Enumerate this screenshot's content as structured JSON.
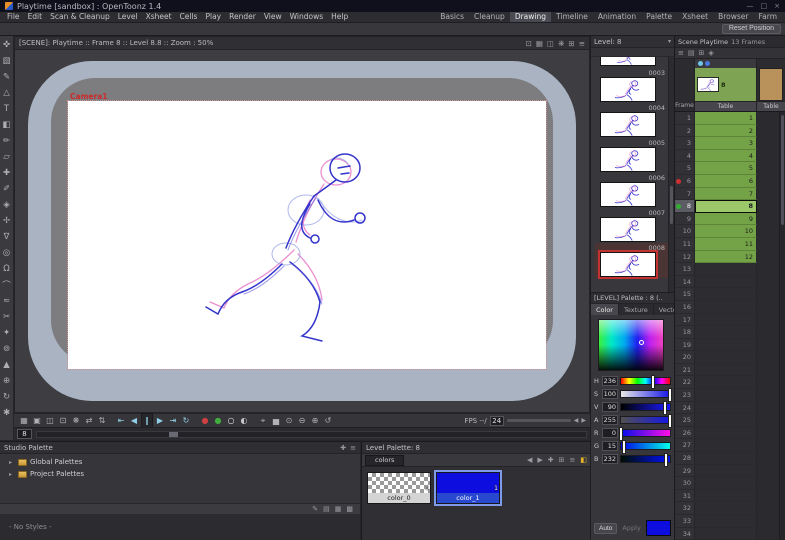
{
  "titlebar": {
    "title": "Playtime [sandbox] : OpenToonz 1.4",
    "window_buttons": [
      {
        "name": "minimize-button",
        "glyph": "—"
      },
      {
        "name": "maximize-button",
        "glyph": "□"
      },
      {
        "name": "close-button",
        "glyph": "×"
      }
    ]
  },
  "menubar": {
    "items": [
      {
        "label": "File",
        "name": "menu-file"
      },
      {
        "label": "Edit",
        "name": "menu-edit"
      },
      {
        "label": "Scan & Cleanup",
        "name": "menu-scan-cleanup"
      },
      {
        "label": "Level",
        "name": "menu-level"
      },
      {
        "label": "Xsheet",
        "name": "menu-xsheet"
      },
      {
        "label": "Cells",
        "name": "menu-cells"
      },
      {
        "label": "Play",
        "name": "menu-play"
      },
      {
        "label": "Render",
        "name": "menu-render"
      },
      {
        "label": "View",
        "name": "menu-view"
      },
      {
        "label": "Windows",
        "name": "menu-windows"
      },
      {
        "label": "Help",
        "name": "menu-help"
      }
    ],
    "rooms": [
      {
        "label": "Basics",
        "name": "room-tab-basics"
      },
      {
        "label": "Cleanup",
        "name": "room-tab-cleanup"
      },
      {
        "label": "Drawing",
        "name": "room-tab-drawing"
      },
      {
        "label": "Timeline",
        "name": "room-tab-timeline"
      },
      {
        "label": "Animation",
        "name": "room-tab-animation"
      },
      {
        "label": "Palette",
        "name": "room-tab-palette"
      },
      {
        "label": "Xsheet",
        "name": "room-tab-xsheet"
      },
      {
        "label": "Browser",
        "name": "room-tab-browser"
      },
      {
        "label": "Farm",
        "name": "room-tab-farm"
      }
    ],
    "active_room_index": 2
  },
  "toolbar_row": {
    "reset_button": "Reset Position"
  },
  "tools": [
    {
      "name": "animate-tool",
      "glyph": "✜"
    },
    {
      "name": "selection-tool",
      "glyph": "▧"
    },
    {
      "name": "brush-tool",
      "glyph": "✎"
    },
    {
      "name": "geometric-tool",
      "glyph": "△"
    },
    {
      "name": "type-tool",
      "glyph": "T"
    },
    {
      "name": "fill-tool",
      "glyph": "◧"
    },
    {
      "name": "paint-brush-tool",
      "glyph": "✏"
    },
    {
      "name": "eraser-tool",
      "glyph": "▱"
    },
    {
      "name": "tape-tool",
      "glyph": "✚"
    },
    {
      "name": "style-picker-tool",
      "glyph": "✐"
    },
    {
      "name": "rgb-picker-tool",
      "glyph": "◈"
    },
    {
      "name": "control-point-editor-tool",
      "glyph": "✢"
    },
    {
      "name": "pinch-tool",
      "glyph": "∇"
    },
    {
      "name": "pump-tool",
      "glyph": "◎"
    },
    {
      "name": "magnet-tool",
      "glyph": "Ω"
    },
    {
      "name": "bender-tool",
      "glyph": "⌒"
    },
    {
      "name": "iron-tool",
      "glyph": "≈"
    },
    {
      "name": "cutter-tool",
      "glyph": "✂"
    },
    {
      "name": "skeleton-tool",
      "glyph": "✦"
    },
    {
      "name": "hook-tool",
      "glyph": "⊚"
    },
    {
      "name": "plastic-tool",
      "glyph": "▲"
    },
    {
      "name": "zoom-tool",
      "glyph": "⊕"
    },
    {
      "name": "rotate-tool",
      "glyph": "↻"
    },
    {
      "name": "hand-tool",
      "glyph": "✱"
    }
  ],
  "viewer": {
    "title": "[SCENE]: Playtime  ::  Frame 8  ::  Level 8.8  ::  Zoom : 50%",
    "camera_label": "Camera1",
    "header_icons": [
      {
        "name": "safe-area-icon",
        "glyph": "⊡"
      },
      {
        "name": "field-guide-icon",
        "glyph": "▦"
      },
      {
        "name": "view-mode-icon",
        "glyph": "◫"
      },
      {
        "name": "freeze-icon",
        "glyph": "❋"
      },
      {
        "name": "sub-camera-icon",
        "glyph": "⊞"
      },
      {
        "name": "viewer-menu-icon",
        "glyph": "≡"
      }
    ],
    "toolbar_icons": [
      {
        "name": "table-view-button",
        "glyph": "▦"
      },
      {
        "name": "standard-view-button",
        "glyph": "▣"
      },
      {
        "name": "3d-view-button",
        "glyph": "◫"
      },
      {
        "name": "camera-view-button",
        "glyph": "⊡"
      },
      {
        "name": "freeze-button",
        "glyph": "❋"
      },
      {
        "name": "flip-x-button",
        "glyph": "⇄"
      },
      {
        "name": "flip-y-button",
        "glyph": "⇅"
      },
      {
        "name": "separator",
        "glyph": ""
      },
      {
        "name": "first-frame-button",
        "glyph": "⇤",
        "style": "color:#8fd0e8"
      },
      {
        "name": "prev-frame-button",
        "glyph": "◀",
        "style": "color:#8fd0e8"
      },
      {
        "name": "pause-button",
        "glyph": "‖",
        "style": "color:#8fd0e8;background:#26262a;border:1px solid #1a1a1e"
      },
      {
        "name": "play-button",
        "glyph": "▶",
        "style": "color:#8fd0e8"
      },
      {
        "name": "last-frame-button",
        "glyph": "⇥",
        "style": "color:#8fd0e8"
      },
      {
        "name": "loop-button",
        "glyph": "↻",
        "style": "color:#8fd0e8"
      },
      {
        "name": "separator",
        "glyph": ""
      },
      {
        "name": "red-channel-button",
        "glyph": "●",
        "style": "color:#d04040"
      },
      {
        "name": "green-channel-button",
        "glyph": "●",
        "style": "color:#3fae3f"
      },
      {
        "name": "matte-channel-button",
        "glyph": "○",
        "style": "color:#e6e6e6"
      },
      {
        "name": "compare-button",
        "glyph": "◐",
        "style": "color:#c8c8c8"
      },
      {
        "name": "separator",
        "glyph": ""
      },
      {
        "name": "locator-button",
        "glyph": "⌖"
      },
      {
        "name": "histogram-button",
        "glyph": "▅"
      },
      {
        "name": "capture-button",
        "glyph": "⊙"
      },
      {
        "name": "zoom-out-button",
        "glyph": "⊖"
      },
      {
        "name": "zoom-in-button",
        "glyph": "⊕"
      },
      {
        "name": "reset-view-button",
        "glyph": "↺"
      }
    ],
    "fps_label": "FPS --/",
    "fps_value": "24",
    "fps_prev_glyph": "◀",
    "fps_next_glyph": "▶",
    "frame_value": "8"
  },
  "level_strip": {
    "title": "Level: 8",
    "menu_glyph": "▾",
    "frames": [
      {
        "num": "0003"
      },
      {
        "num": "0004"
      },
      {
        "num": "0005"
      },
      {
        "num": "0006"
      },
      {
        "num": "0007"
      },
      {
        "num": "0008",
        "selected": true
      }
    ]
  },
  "palette_editor": {
    "title": "[LEVEL] Palette : 8 (..",
    "tabs": [
      "Color",
      "Texture",
      "Vector"
    ],
    "active_tab_index": 0,
    "sliders": [
      {
        "label": "H",
        "value": 236,
        "max": 359
      },
      {
        "label": "S",
        "value": 100,
        "max": 100
      },
      {
        "label": "V",
        "value": 90,
        "max": 100
      },
      {
        "label": "A",
        "value": 255,
        "max": 255
      },
      {
        "label": "R",
        "value": 0,
        "max": 255
      },
      {
        "label": "G",
        "value": 15,
        "max": 255
      },
      {
        "label": "B",
        "value": 232,
        "max": 255
      }
    ],
    "auto_label": "Auto",
    "apply_label": "Apply",
    "current_color": "#0d0de0"
  },
  "xsheet": {
    "title": "Scene Playtime",
    "frames_label": "13 Frames",
    "toolbar_icons": [
      {
        "name": "xsheet-menu-icon",
        "glyph": "≡"
      },
      {
        "name": "frame-range-icon",
        "glyph": "▤"
      },
      {
        "name": "add-column-icon",
        "glyph": "⊞"
      },
      {
        "name": "onion-skin-icon",
        "glyph": "◈"
      }
    ],
    "column_name": "8",
    "table_label": "Table",
    "frame_label": "Frame",
    "current_frame": 8,
    "rows": [
      {
        "f": 1,
        "c": "1"
      },
      {
        "f": 2,
        "c": "2"
      },
      {
        "f": 3,
        "c": "3"
      },
      {
        "f": 4,
        "c": "4"
      },
      {
        "f": 5,
        "c": "5"
      },
      {
        "f": 6,
        "c": "6",
        "marker": "red"
      },
      {
        "f": 7,
        "c": "7"
      },
      {
        "f": 8,
        "c": "8",
        "marker": "green"
      },
      {
        "f": 9,
        "c": "9"
      },
      {
        "f": 10,
        "c": "10"
      },
      {
        "f": 11,
        "c": "11"
      },
      {
        "f": 12,
        "c": "12"
      },
      {
        "f": 13
      },
      {
        "f": 14
      },
      {
        "f": 15
      },
      {
        "f": 16
      },
      {
        "f": 17
      },
      {
        "f": 18
      },
      {
        "f": 19
      },
      {
        "f": 20
      },
      {
        "f": 21
      },
      {
        "f": 22
      },
      {
        "f": 23
      },
      {
        "f": 24
      },
      {
        "f": 25
      },
      {
        "f": 26
      },
      {
        "f": 27
      },
      {
        "f": 28
      },
      {
        "f": 29
      },
      {
        "f": 30
      },
      {
        "f": 31
      },
      {
        "f": 32
      },
      {
        "f": 33
      },
      {
        "f": 34
      }
    ]
  },
  "studio_palette": {
    "title": "Studio Palette",
    "header_icons": [
      {
        "name": "new-palette-icon",
        "glyph": "✚"
      },
      {
        "name": "studio-palette-menu-icon",
        "glyph": "≡"
      }
    ],
    "tree": [
      {
        "label": "Global Palettes",
        "name": "tree-item-global-palettes",
        "arrow": "▸"
      },
      {
        "label": "Project Palettes",
        "name": "tree-item-project-palettes",
        "arrow": "▸"
      }
    ],
    "toolbar_icons": [
      {
        "name": "edit-style-icon",
        "glyph": "✎"
      },
      {
        "name": "name-view-icon",
        "glyph": "▤"
      },
      {
        "name": "small-thumbs-icon",
        "glyph": "▦"
      },
      {
        "name": "large-thumbs-icon",
        "glyph": "▩"
      }
    ],
    "empty_label": "- No Styles -"
  },
  "level_palette": {
    "title": "Level Palette: 8",
    "page_tab": "colors",
    "toolbar_icons": [
      {
        "name": "prev-page-icon",
        "glyph": "◀"
      },
      {
        "name": "next-page-icon",
        "glyph": "▶"
      },
      {
        "name": "new-style-icon",
        "glyph": "✚"
      },
      {
        "name": "new-page-icon",
        "glyph": "⊞"
      },
      {
        "name": "palette-options-icon",
        "glyph": "≡"
      },
      {
        "name": "style-editor-icon",
        "glyph": "◧",
        "style": "color:#e8b428"
      }
    ],
    "swatches": [
      {
        "name": "color_0",
        "index": "0",
        "checker": true
      },
      {
        "name": "color_1",
        "index": "1",
        "color": "#0d0de0",
        "selected": true
      }
    ]
  },
  "colors": {
    "cell_green": "#74a347",
    "selected_cell_green": "#9cc86a",
    "current_style_blue": "#0d0de0",
    "camera_label_red": "#cc2a2a",
    "desk_grey_blue": "#a9b3c2"
  }
}
